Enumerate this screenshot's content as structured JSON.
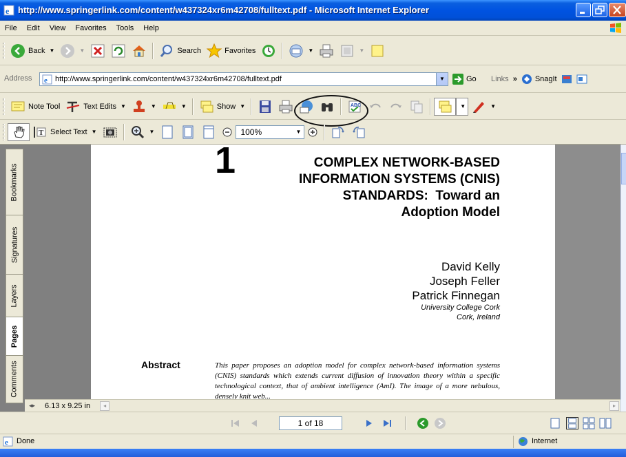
{
  "window": {
    "title": "http://www.springerlink.com/content/w437324xr6m42708/fulltext.pdf - Microsoft Internet Explorer"
  },
  "menu": [
    "File",
    "Edit",
    "View",
    "Favorites",
    "Tools",
    "Help"
  ],
  "std_toolbar": {
    "back": "Back",
    "search": "Search",
    "favorites": "Favorites"
  },
  "address_bar": {
    "label": "Address",
    "url": "http://www.springerlink.com/content/w437324xr6m42708/fulltext.pdf",
    "go": "Go",
    "links": "Links",
    "snagit": "SnagIt"
  },
  "pdf_toolbar": {
    "note_tool": "Note Tool",
    "text_edits": "Text Edits",
    "show": "Show",
    "select_text": "Select Text",
    "zoom": "100%"
  },
  "nav_tabs": [
    "Bookmarks",
    "Signatures",
    "Layers",
    "Pages",
    "Comments"
  ],
  "document": {
    "chapter_number": "1",
    "title_lines": [
      "COMPLEX NETWORK-BASED",
      "INFORMATION SYSTEMS (CNIS)",
      "STANDARDS:  Toward an",
      "Adoption Model"
    ],
    "authors": [
      "David Kelly",
      "Joseph Feller",
      "Patrick Finnegan"
    ],
    "affiliation_lines": [
      "University College Cork",
      "Cork, Ireland"
    ],
    "abstract_label": "Abstract",
    "abstract_text": "This paper proposes an adoption model for complex network-based information systems (CNIS) standards which extends current diffusion of innovation theory within a specific technological context, that of ambient intelligence (AmI). The image of a more nebulous, densely knit web..."
  },
  "page_size": "6.13 x 9.25 in",
  "page_nav": {
    "page_indicator": "1 of 18"
  },
  "status_bar": {
    "status": "Done",
    "zone": "Internet"
  }
}
